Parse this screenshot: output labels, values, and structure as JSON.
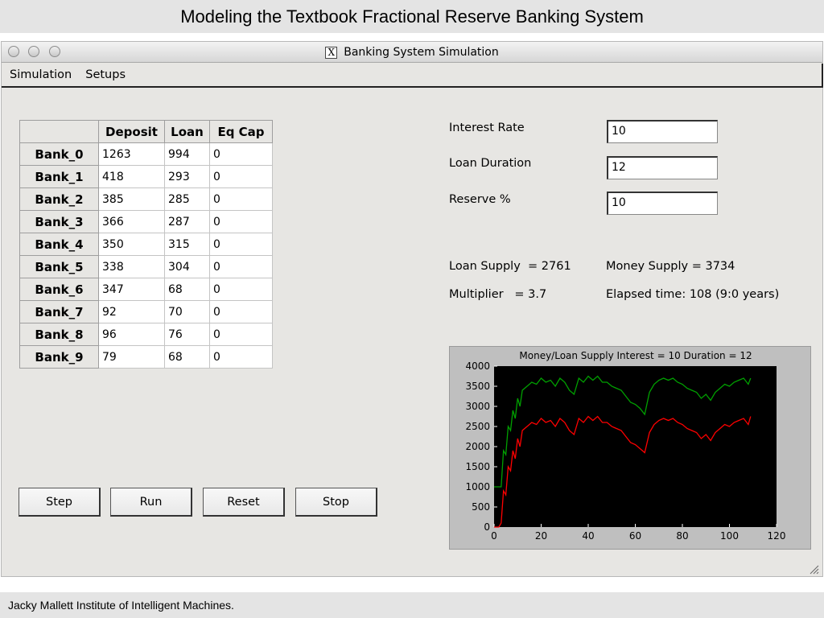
{
  "slide": {
    "title": "Modeling the Textbook Fractional Reserve Banking System",
    "footer": "Jacky Mallett Institute of Intelligent Machines."
  },
  "window": {
    "title": "Banking System Simulation",
    "icon": "x11-icon"
  },
  "menu": [
    "Simulation",
    "Setups"
  ],
  "table": {
    "headers": [
      "",
      "Deposit",
      "Loan",
      "Eq Cap"
    ],
    "rows": [
      {
        "name": "Bank_0",
        "deposit": "1263",
        "loan": "994",
        "eqcap": "0"
      },
      {
        "name": "Bank_1",
        "deposit": "418",
        "loan": "293",
        "eqcap": "0"
      },
      {
        "name": "Bank_2",
        "deposit": "385",
        "loan": "285",
        "eqcap": "0"
      },
      {
        "name": "Bank_3",
        "deposit": "366",
        "loan": "287",
        "eqcap": "0"
      },
      {
        "name": "Bank_4",
        "deposit": "350",
        "loan": "315",
        "eqcap": "0"
      },
      {
        "name": "Bank_5",
        "deposit": "338",
        "loan": "304",
        "eqcap": "0"
      },
      {
        "name": "Bank_6",
        "deposit": "347",
        "loan": "68",
        "eqcap": "0"
      },
      {
        "name": "Bank_7",
        "deposit": "92",
        "loan": "70",
        "eqcap": "0"
      },
      {
        "name": "Bank_8",
        "deposit": "96",
        "loan": "76",
        "eqcap": "0"
      },
      {
        "name": "Bank_9",
        "deposit": "79",
        "loan": "68",
        "eqcap": "0"
      }
    ]
  },
  "buttons": [
    "Step",
    "Run",
    "Reset",
    "Stop"
  ],
  "params": [
    {
      "label": "Interest Rate",
      "value": "10"
    },
    {
      "label": "Loan Duration",
      "value": "12"
    },
    {
      "label": "Reserve %",
      "value": "10"
    }
  ],
  "stats": {
    "loan_supply": "Loan Supply  = 2761",
    "money_supply": "Money Supply = 3734",
    "multiplier": "Multiplier   = 3.7",
    "elapsed": "Elapsed time: 108 (9:0 years)"
  },
  "colors": {
    "money_series": "#00a000",
    "loan_series": "#ff0000",
    "plot_bg": "#000000"
  },
  "chart_data": {
    "type": "line",
    "title": "Money/Loan Supply Interest = 10 Duration = 12",
    "xlabel": "",
    "ylabel": "",
    "xlim": [
      0,
      120
    ],
    "ylim": [
      0,
      4000
    ],
    "xticks": [
      0,
      20,
      40,
      60,
      80,
      100,
      120
    ],
    "yticks": [
      0,
      500,
      1000,
      1500,
      2000,
      2500,
      3000,
      3500,
      4000
    ],
    "grid": false,
    "series": [
      {
        "color": "#00a000",
        "x": [
          0,
          1,
          2,
          3,
          4,
          5,
          6,
          7,
          8,
          9,
          10,
          11,
          12,
          14,
          16,
          18,
          20,
          22,
          24,
          26,
          28,
          30,
          32,
          34,
          36,
          38,
          40,
          42,
          44,
          46,
          48,
          50,
          52,
          54,
          56,
          58,
          60,
          62,
          64,
          66,
          68,
          70,
          72,
          74,
          76,
          78,
          80,
          82,
          84,
          86,
          88,
          90,
          92,
          94,
          96,
          98,
          100,
          102,
          104,
          106,
          108,
          109
        ],
        "y": [
          1000,
          1000,
          1000,
          1000,
          1900,
          1800,
          2500,
          2400,
          2900,
          2700,
          3200,
          3000,
          3400,
          3500,
          3600,
          3550,
          3700,
          3600,
          3650,
          3500,
          3700,
          3600,
          3400,
          3300,
          3700,
          3600,
          3750,
          3650,
          3750,
          3600,
          3600,
          3500,
          3450,
          3400,
          3250,
          3100,
          3050,
          2950,
          2800,
          3350,
          3550,
          3650,
          3700,
          3650,
          3700,
          3600,
          3550,
          3450,
          3400,
          3350,
          3200,
          3300,
          3150,
          3350,
          3450,
          3550,
          3500,
          3600,
          3650,
          3700,
          3550,
          3700
        ]
      },
      {
        "color": "#ff0000",
        "x": [
          0,
          1,
          2,
          3,
          4,
          5,
          6,
          7,
          8,
          9,
          10,
          11,
          12,
          14,
          16,
          18,
          20,
          22,
          24,
          26,
          28,
          30,
          32,
          34,
          36,
          38,
          40,
          42,
          44,
          46,
          48,
          50,
          52,
          54,
          56,
          58,
          60,
          62,
          64,
          66,
          68,
          70,
          72,
          74,
          76,
          78,
          80,
          82,
          84,
          86,
          88,
          90,
          92,
          94,
          96,
          98,
          100,
          102,
          104,
          106,
          108,
          109
        ],
        "y": [
          0,
          0,
          0,
          100,
          900,
          800,
          1500,
          1400,
          1900,
          1700,
          2200,
          2000,
          2400,
          2500,
          2600,
          2550,
          2700,
          2600,
          2650,
          2500,
          2700,
          2600,
          2400,
          2300,
          2700,
          2600,
          2750,
          2650,
          2750,
          2600,
          2600,
          2500,
          2450,
          2400,
          2250,
          2100,
          2050,
          1950,
          1850,
          2350,
          2550,
          2650,
          2700,
          2650,
          2700,
          2600,
          2550,
          2450,
          2400,
          2350,
          2200,
          2300,
          2150,
          2350,
          2450,
          2550,
          2500,
          2600,
          2650,
          2700,
          2550,
          2750
        ]
      }
    ]
  }
}
